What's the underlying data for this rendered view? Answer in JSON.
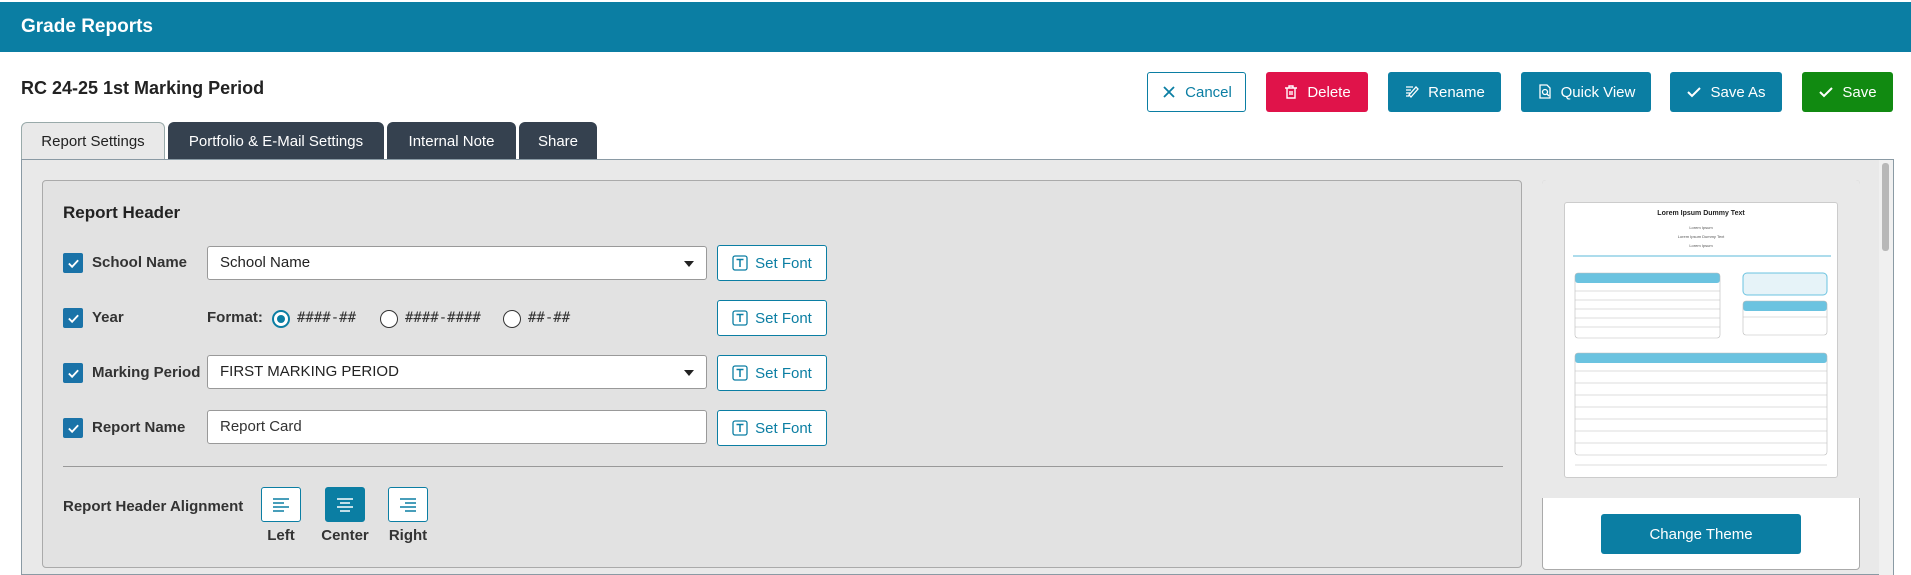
{
  "app": {
    "title": "Grade Reports"
  },
  "report": {
    "title": "RC 24-25 1st Marking Period"
  },
  "toolbar": {
    "cancel": "Cancel",
    "delete": "Delete",
    "rename": "Rename",
    "quick_view": "Quick View",
    "save_as": "Save As",
    "save": "Save"
  },
  "tabs": [
    {
      "label": "Report Settings",
      "active": true
    },
    {
      "label": "Portfolio & E-Mail Settings",
      "active": false
    },
    {
      "label": "Internal Note",
      "active": false
    },
    {
      "label": "Share",
      "active": false
    }
  ],
  "header_section": {
    "title": "Report Header",
    "set_font_label": "Set Font",
    "school_name": {
      "label": "School Name",
      "checked": true,
      "value": "School Name"
    },
    "year": {
      "label": "Year",
      "checked": true,
      "format_label": "Format:",
      "options": [
        "####-##",
        "####-####",
        "##-##"
      ],
      "selected": "####-##"
    },
    "marking_period": {
      "label": "Marking Period",
      "checked": true,
      "value": "FIRST MARKING PERIOD"
    },
    "report_name": {
      "label": "Report Name",
      "checked": true,
      "value": "Report Card"
    },
    "alignment": {
      "label": "Report Header Alignment",
      "options": [
        "Left",
        "Center",
        "Right"
      ],
      "selected": "Center"
    }
  },
  "preview": {
    "doc_title": "Lorem Ipsum Dummy Text",
    "doc_subtitle": "Lorem Ipsum",
    "doc_line2": "Lorem Ipsum Dummy Text",
    "doc_line3": "Lorem Ipsum",
    "change_theme": "Change Theme"
  },
  "colors": {
    "brand": "#0b7ea3",
    "danger": "#e0134a",
    "success": "#118a11",
    "tab_dark": "#35414f"
  }
}
